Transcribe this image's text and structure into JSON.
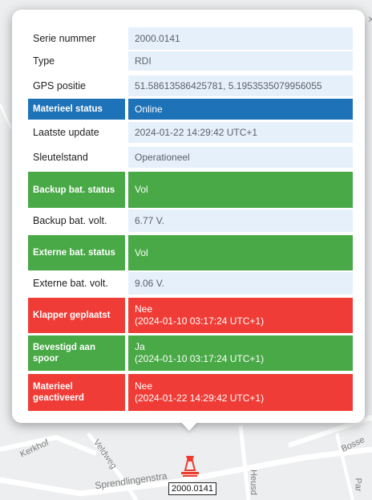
{
  "popup": {
    "close_label": "×",
    "rows": [
      {
        "label": "Serie nummer",
        "value": "2000.0141"
      },
      {
        "label": "Type",
        "value": "RDI"
      },
      {
        "label": "GPS positie",
        "value": "51.58613586425781, 5.1953535079956055"
      },
      {
        "label": "Materieel status",
        "value": "Online"
      },
      {
        "label": "Laatste update",
        "value": "2024-01-22 14:29:42 UTC+1"
      },
      {
        "label": "Sleutelstand",
        "value": "Operationeel"
      },
      {
        "label": "Backup bat. status",
        "value": "Vol"
      },
      {
        "label": "Backup bat. volt.",
        "value": "6.77 V."
      },
      {
        "label": "Externe bat. status",
        "value": "Vol"
      },
      {
        "label": "Externe bat. volt.",
        "value": "9.06 V."
      },
      {
        "label": "Klapper geplaatst",
        "value": "Nee\n(2024-01-10 03:17:24 UTC+1)"
      },
      {
        "label": "Bevestigd aan spoor",
        "value": "Ja\n(2024-01-10 03:17:24 UTC+1)"
      },
      {
        "label": "Materieel geactiveerd",
        "value": "Nee\n(2024-01-22 14:29:42 UTC+1)"
      }
    ]
  },
  "map": {
    "street_labels": [
      "Kerkhof",
      "Veldweg",
      "Sprendlingenstra",
      "Heusd",
      "Bosse",
      "Par"
    ],
    "marker_label": "2000.0141",
    "marker_icon": "train-device-icon"
  },
  "colors": {
    "status_blue": "#1e72b8",
    "status_green": "#48a946",
    "status_red": "#f03c36",
    "value_background": "#e6f0fb"
  }
}
